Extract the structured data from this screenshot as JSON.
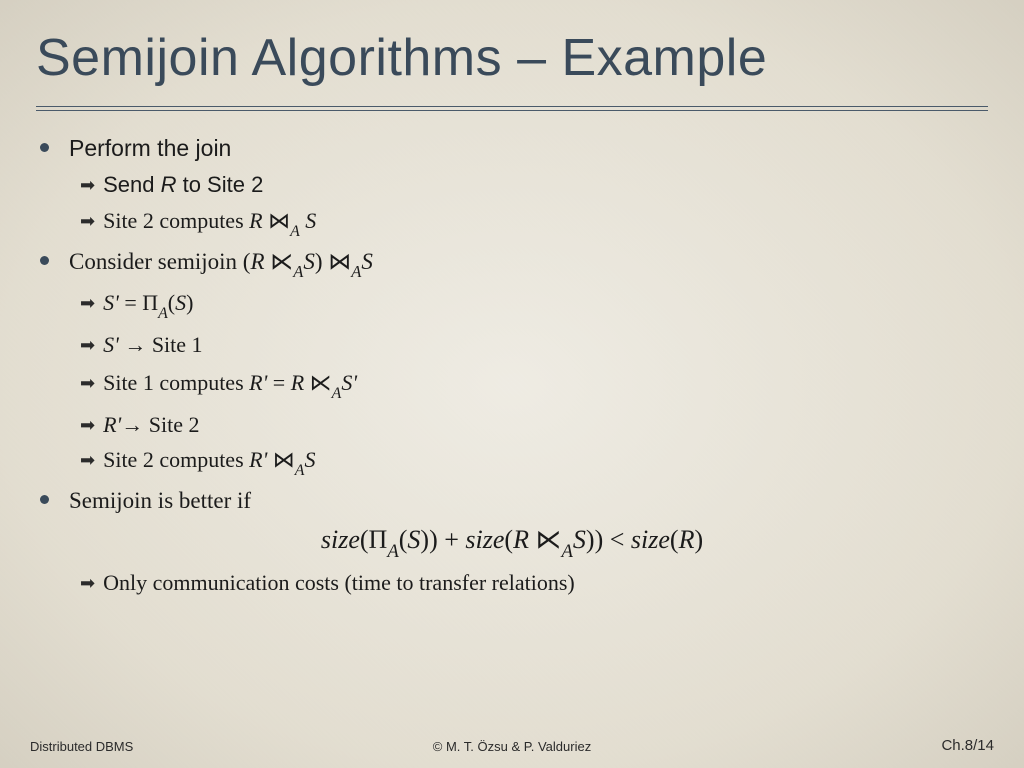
{
  "title": "Semijoin Algorithms – Example",
  "bullets": {
    "b1": {
      "text": "Perform the join"
    },
    "b1s1": {
      "prefix": "Send ",
      "ital1": "R",
      "post": " to Site 2"
    },
    "b1s2": {
      "prefix": "Site 2 computes ",
      "R": "R",
      "join": " ⋈",
      "A": "A",
      "S": " S"
    },
    "b2": {
      "prefix": "Consider semijoin (",
      "R": "R",
      "lsj": " ⋉",
      "A1": "A",
      "S1": "S",
      "mid": ") ⋈",
      "A2": "A",
      "S2": "S"
    },
    "b2s1": {
      "Sp": "S'",
      "eq": " = ",
      "Pi": "Π",
      "A": "A",
      "open": "(",
      "S": "S",
      "close": ")"
    },
    "b2s2": {
      "Sp": "S'",
      "arrow": " → ",
      "site": "Site 1"
    },
    "b2s3": {
      "prefix": "Site 1 computes ",
      "Rp": "R'",
      "eq": " = ",
      "R": "R",
      "lsj": " ⋉",
      "A": "A",
      "Sp2": "S'"
    },
    "b2s4": {
      "Rp": "R'",
      "arrow": "→ ",
      "site": "Site 2"
    },
    "b2s5": {
      "prefix": "Site 2 computes ",
      "Rp": "R'",
      "join": " ⋈",
      "A": "A",
      "S": "S"
    },
    "b3": {
      "text": "Semijoin is better if"
    },
    "formula": {
      "p1": "size",
      "open1": "(",
      "Pi": "Π",
      "A1": "A",
      "op2": "(",
      "S1": "S",
      "cl2": ")) + ",
      "p2": "size",
      "op3": "(",
      "R": "R",
      "lsj": " ⋉",
      "A2": "A",
      "S2": "S",
      "cl3": ")) < ",
      "p3": "size",
      "op4": "(",
      "R2": "R",
      "cl4": ")"
    },
    "b3s1": {
      "text": "Only communication costs (time to transfer relations)"
    }
  },
  "footer": {
    "left": "Distributed DBMS",
    "center": "© M. T. Özsu & P. Valduriez",
    "right": "Ch.8/14"
  }
}
